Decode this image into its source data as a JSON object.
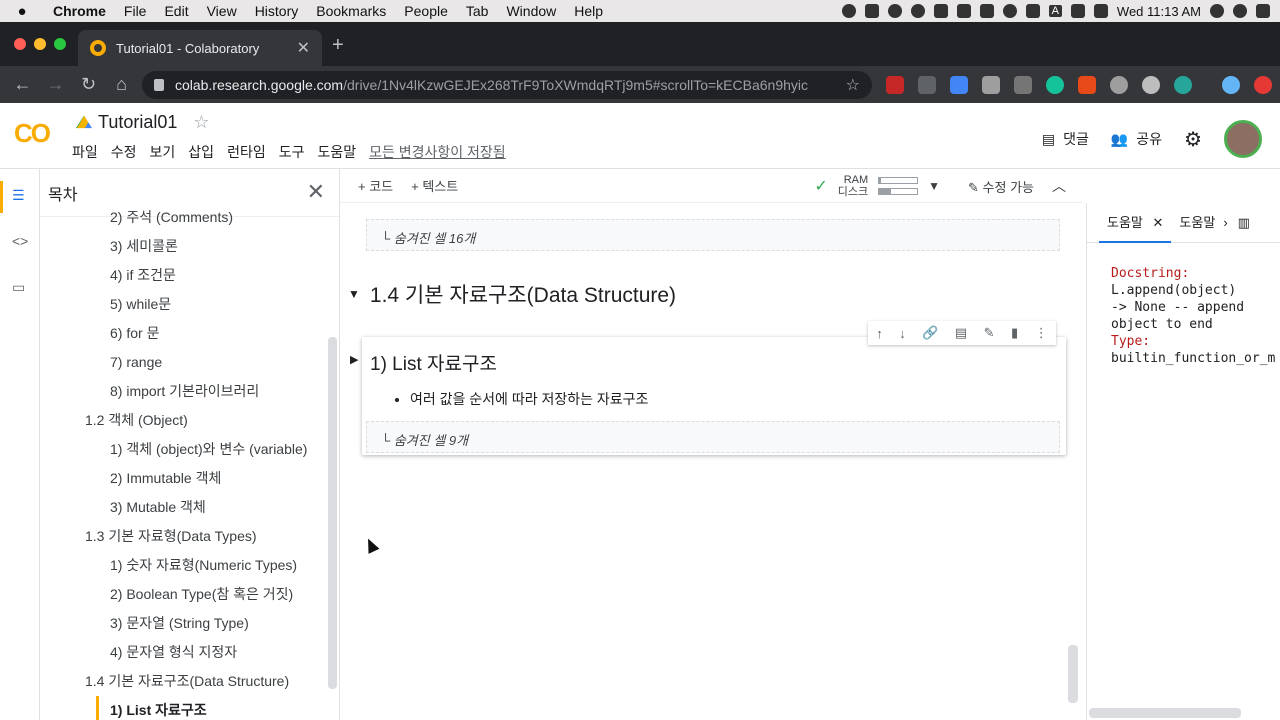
{
  "macos": {
    "app": "Chrome",
    "menu": [
      "File",
      "Edit",
      "View",
      "History",
      "Bookmarks",
      "People",
      "Tab",
      "Window",
      "Help"
    ],
    "clock": "Wed 11:13 AM",
    "input_badge": "A"
  },
  "browser": {
    "tab_title": "Tutorial01 - Colaboratory",
    "url_host": "colab.research.google.com",
    "url_path": "/drive/1Nv4lKzwGEJEx268TrF9ToXWmdqRTj9m5#scrollTo=kECBa6n9hyic"
  },
  "colab": {
    "logo": "CO",
    "doc_title": "Tutorial01",
    "menus": [
      "파일",
      "수정",
      "보기",
      "삽입",
      "런타임",
      "도구",
      "도움말"
    ],
    "saved_status": "모든 변경사항이 저장됨",
    "comment_label": "댓글",
    "share_label": "공유"
  },
  "toc": {
    "title": "목차",
    "items": [
      {
        "label": "2) 주석 (Comments)",
        "level": 3
      },
      {
        "label": "3) 세미콜론",
        "level": 3
      },
      {
        "label": "4) if 조건문",
        "level": 3
      },
      {
        "label": "5) while문",
        "level": 3
      },
      {
        "label": "6) for 문",
        "level": 3
      },
      {
        "label": "7) range",
        "level": 3
      },
      {
        "label": "8) import 기본라이브러리",
        "level": 3
      },
      {
        "label": "1.2 객체 (Object)",
        "level": 2
      },
      {
        "label": "1) 객체 (object)와 변수 (variable)",
        "level": 3
      },
      {
        "label": "2) Immutable 객체",
        "level": 3
      },
      {
        "label": "3) Mutable 객체",
        "level": 3
      },
      {
        "label": "1.3 기본 자료형(Data Types)",
        "level": 2
      },
      {
        "label": "1) 숫자 자료형(Numeric Types)",
        "level": 3
      },
      {
        "label": "2) Boolean Type(참 혹은 거짓)",
        "level": 3
      },
      {
        "label": "3) 문자열 (String Type)",
        "level": 3
      },
      {
        "label": "4) 문자열 형식 지정자",
        "level": 3
      },
      {
        "label": "1.4 기본 자료구조(Data Structure)",
        "level": 2
      },
      {
        "label": "1) List 자료구조",
        "level": 3,
        "current": true
      }
    ]
  },
  "toolbar": {
    "add_code": "+ 코드",
    "add_text": "+ 텍스트",
    "ram_label": "RAM",
    "disk_label": "디스크",
    "ram_fraction": 0.05,
    "disk_fraction": 0.3,
    "edit_label": "수정 가능"
  },
  "notebook": {
    "hidden_cells_top": "숨겨진 셀 16개",
    "section_title": "1.4 기본 자료구조(Data Structure)",
    "cell_title": "1) List 자료구조",
    "cell_bullet": "여러 값을 순서에 따라 저장하는 자료구조",
    "hidden_cells_inner": "숨겨진 셀 9개"
  },
  "help": {
    "tab1": "도움말",
    "tab2": "도움말",
    "docstring_label": "Docstring:",
    "docstring": "L.append(object)\n-> None -- append\nobject to end",
    "type_label": "Type:",
    "type_value": "builtin_function_or_m"
  }
}
